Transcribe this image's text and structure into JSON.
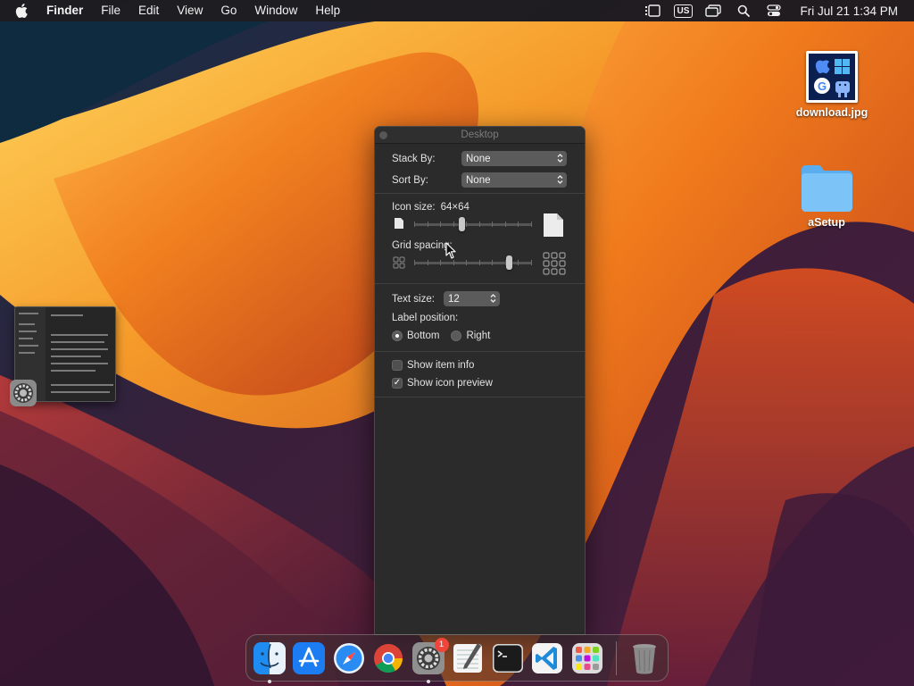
{
  "menubar": {
    "app_name": "Finder",
    "menus": [
      "File",
      "Edit",
      "View",
      "Go",
      "Window",
      "Help"
    ],
    "input_source": "US",
    "clock": "Fri Jul 21  1:34 PM"
  },
  "desktop": {
    "icons": [
      {
        "label": "download.jpg",
        "icon": "image-file-icon"
      },
      {
        "label": "aSetup",
        "icon": "folder-icon"
      }
    ]
  },
  "panel": {
    "title": "Desktop",
    "stack_by": {
      "label": "Stack By:",
      "value": "None"
    },
    "sort_by": {
      "label": "Sort By:",
      "value": "None"
    },
    "icon_size": {
      "label": "Icon size:",
      "value": "64×64",
      "fraction": 0.4
    },
    "grid_spacing": {
      "label": "Grid spacing:",
      "fraction": 0.82
    },
    "text_size": {
      "label": "Text size:",
      "value": "12"
    },
    "label_position": {
      "label": "Label position:",
      "options": [
        "Bottom",
        "Right"
      ],
      "selected": "Bottom"
    },
    "show_item_info": {
      "label": "Show item info",
      "checked": false
    },
    "show_icon_preview": {
      "label": "Show icon preview",
      "checked": true
    }
  },
  "dock": {
    "apps": [
      "Finder",
      "App Store",
      "Safari",
      "Google Chrome",
      "System Settings",
      "TextEdit",
      "Terminal",
      "Visual Studio Code",
      "Launchpad",
      "Trash"
    ],
    "settings_badge": "1"
  },
  "colors": {
    "accent": "#3a8ee6",
    "badge": "#f0453a"
  }
}
